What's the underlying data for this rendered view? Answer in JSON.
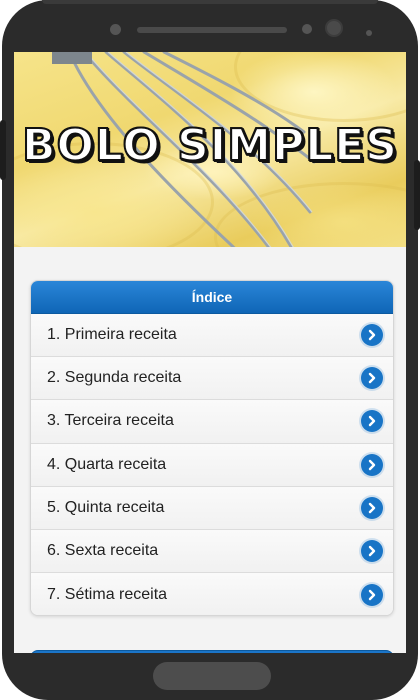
{
  "banner": {
    "title": "BOLO SIMPLES"
  },
  "index": {
    "header": "Índice",
    "items": [
      {
        "label": "1. Primeira receita"
      },
      {
        "label": "2. Segunda receita"
      },
      {
        "label": "3. Terceira receita"
      },
      {
        "label": "4. Quarta receita"
      },
      {
        "label": "5. Quinta receita"
      },
      {
        "label": "6. Sexta receita"
      },
      {
        "label": "7. Sétima receita"
      }
    ]
  },
  "colors": {
    "accent": "#1b75c8",
    "header_text": "#ffffff",
    "phone_frame": "#2b2b2b"
  },
  "icons": {
    "item_action": "chevron-right-icon"
  }
}
